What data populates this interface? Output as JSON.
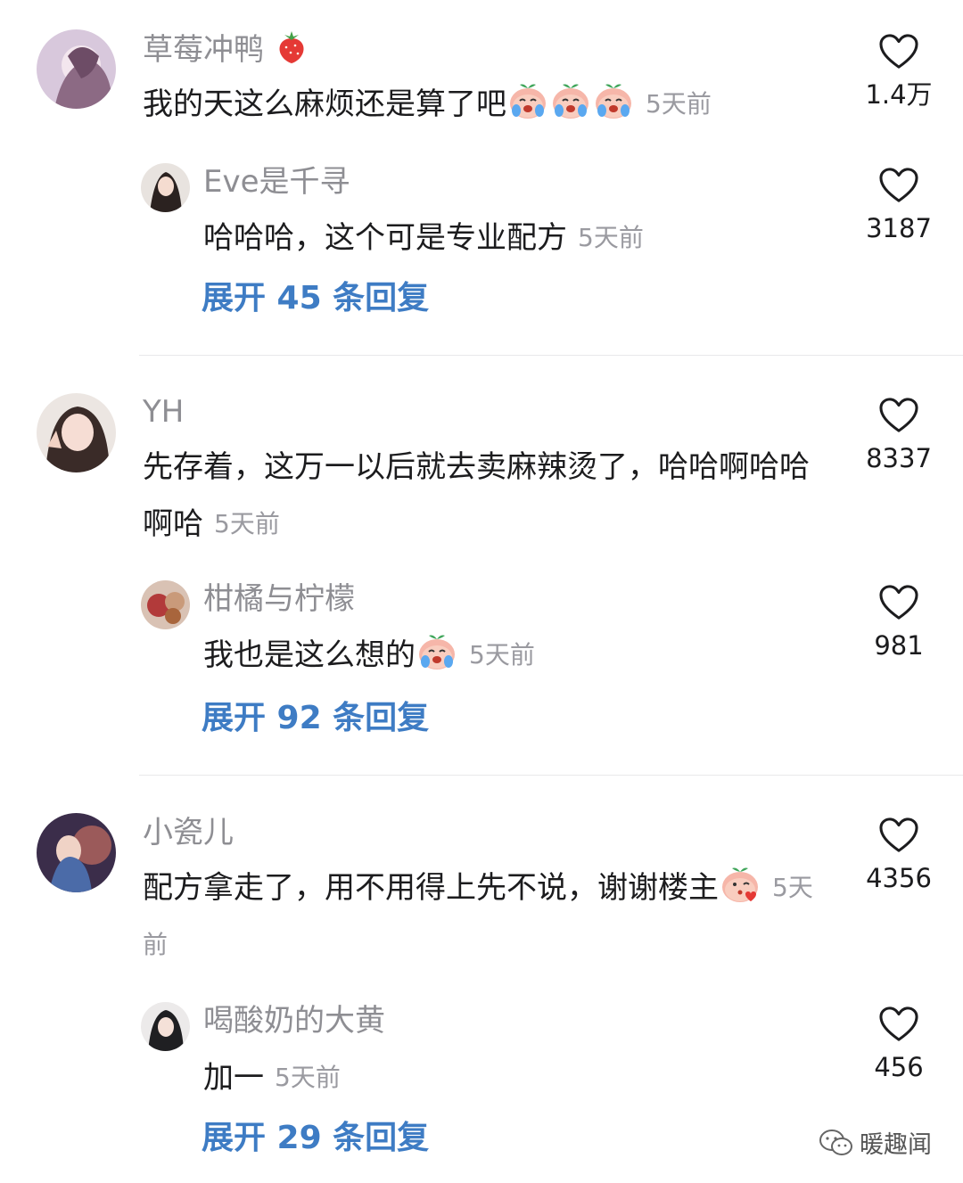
{
  "comments": [
    {
      "user": "草莓冲鸭",
      "text": "我的天这么麻烦还是算了吧",
      "time": "5天前",
      "likes": "1.4万",
      "reply": {
        "user": "Eve是千寻",
        "text": "哈哈哈，这个可是专业配方",
        "time": "5天前",
        "likes": "3187"
      },
      "expand_label": "展开 45 条回复"
    },
    {
      "user": "YH",
      "text": "先存着，这万一以后就去卖麻辣烫了，哈哈啊哈哈啊哈",
      "time": "5天前",
      "likes": "8337",
      "reply": {
        "user": "柑橘与柠檬",
        "text": "我也是这么想的",
        "time": "5天前",
        "likes": "981"
      },
      "expand_label": "展开 92 条回复"
    },
    {
      "user": "小瓷儿",
      "text": "配方拿走了，用不用得上先不说，谢谢楼主",
      "time": "5天前",
      "likes": "4356",
      "reply": {
        "user": "喝酸奶的大黄",
        "text": "加一",
        "time": "5天前",
        "likes": "456"
      },
      "expand_label": "展开 29 条回复"
    }
  ],
  "watermark": "暖趣闻",
  "icons": {
    "like": "heart-outline-icon",
    "emoji_cry": "crying-peach-emoji",
    "emoji_kiss": "kissing-peach-emoji",
    "strawberry": "strawberry-emoji"
  },
  "colors": {
    "link": "#3e7cc4",
    "meta": "#8e8e93",
    "text": "#1c1c1e"
  }
}
